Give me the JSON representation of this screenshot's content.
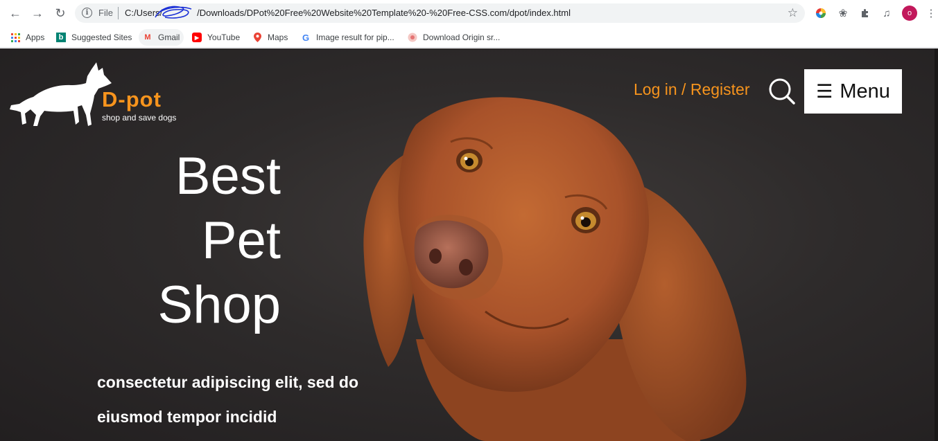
{
  "browser": {
    "url_scheme": "File",
    "url": "C:/Users/",
    "url_rest": "Downloads/DPot%20Free%20Website%20Template%20-%20Free-CSS.com/dpot/index.html",
    "profile_initial": "o",
    "bookmarks": [
      {
        "label": "Apps",
        "icon": "apps-grid-icon"
      },
      {
        "label": "Suggested Sites",
        "icon": "bing-icon"
      },
      {
        "label": "Gmail",
        "icon": "gmail-icon"
      },
      {
        "label": "YouTube",
        "icon": "youtube-icon"
      },
      {
        "label": "Maps",
        "icon": "maps-pin-icon"
      },
      {
        "label": "Image result for pip...",
        "icon": "google-icon"
      },
      {
        "label": "Download Origin sr...",
        "icon": "origin-icon"
      }
    ]
  },
  "site": {
    "logo_name": "D-pot",
    "logo_tagline": "shop and save dogs",
    "login_label": "Log in / Register",
    "menu_label": "Menu",
    "headline": [
      "Best",
      "Pet",
      "Shop"
    ],
    "subtext": [
      "consectetur adipiscing elit, sed do",
      "eiusmod tempor incidid"
    ]
  },
  "colors": {
    "accent": "#f7941d",
    "hero_bg": "#2e2b2b",
    "text": "#ffffff"
  }
}
